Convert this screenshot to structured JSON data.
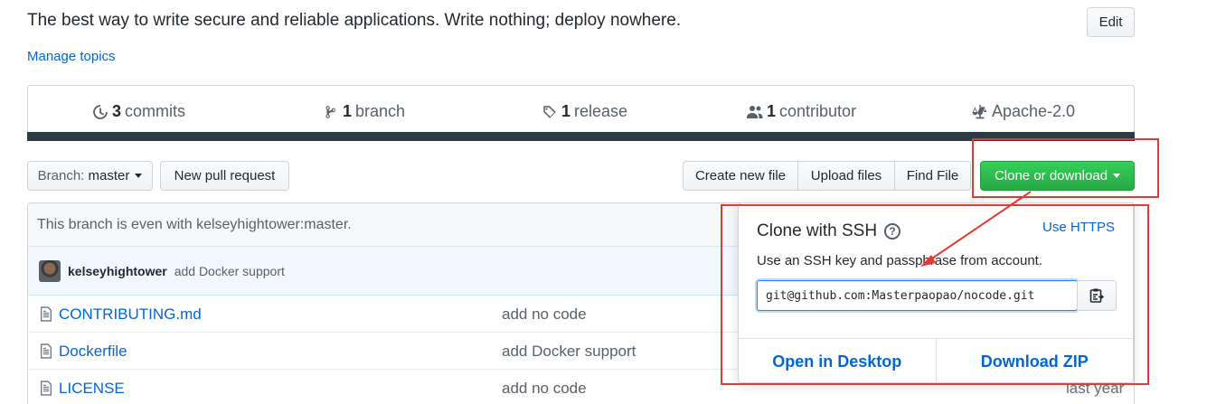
{
  "repo": {
    "description": "The best way to write secure and reliable applications. Write nothing; deploy nowhere.",
    "manage_topics": "Manage topics",
    "edit_label": "Edit"
  },
  "summary": {
    "commits_count": "3",
    "commits_label": "commits",
    "branch_count": "1",
    "branch_label": "branch",
    "release_count": "1",
    "release_label": "release",
    "contributor_count": "1",
    "contributor_label": "contributor",
    "license": "Apache-2.0"
  },
  "toolbar": {
    "branch_prefix": "Branch:",
    "branch_name": "master",
    "new_pr": "New pull request",
    "create_file": "Create new file",
    "upload_files": "Upload files",
    "find_file": "Find File",
    "clone": "Clone or download"
  },
  "branch_status": "This branch is even with kelseyhightower:master.",
  "latest_commit": {
    "author": "kelseyhightower",
    "message": "add Docker support"
  },
  "files": [
    {
      "name": "CONTRIBUTING.md",
      "message": "add no code",
      "age": ""
    },
    {
      "name": "Dockerfile",
      "message": "add Docker support",
      "age": ""
    },
    {
      "name": "LICENSE",
      "message": "add no code",
      "age": "last year"
    }
  ],
  "clone_popover": {
    "title": "Clone with SSH",
    "use_https": "Use HTTPS",
    "subtitle": "Use an SSH key and passphrase from account.",
    "url": "git@github.com:Masterpaopao/nocode.git",
    "open_desktop": "Open in Desktop",
    "download_zip": "Download ZIP"
  },
  "colors": {
    "accent_link": "#0366d6",
    "clone_green": "#28a745",
    "annotation_red": "#e53935",
    "summary_bar": "#2b3b42"
  }
}
